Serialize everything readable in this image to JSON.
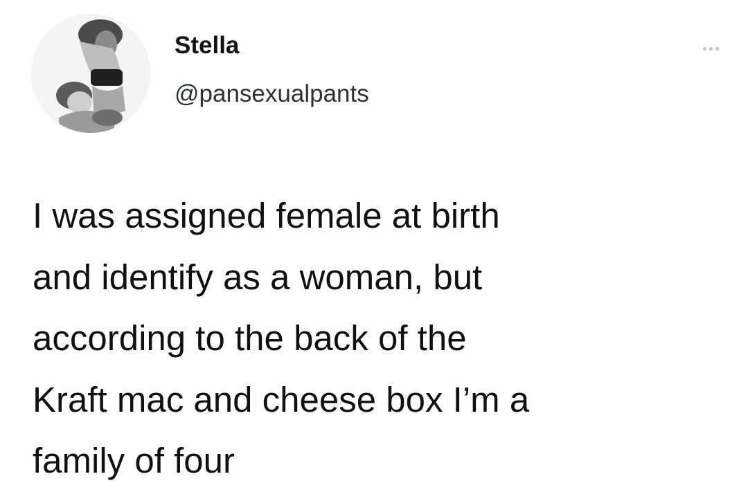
{
  "author": {
    "display_name": "Stella",
    "handle": "@pansexualpants",
    "avatar_icon": "profile-photo"
  },
  "menu": {
    "icon": "more-horizontal-icon"
  },
  "tweet": {
    "lines": [
      "I was assigned female at birth",
      "and identify as a woman, but",
      "according to the back of the",
      "Kraft mac and cheese box I’m a",
      "family of four"
    ]
  },
  "colors": {
    "text": "#111111",
    "handle": "#2d3236",
    "background": "#ffffff",
    "menu_dots": "#c0c4c8"
  }
}
